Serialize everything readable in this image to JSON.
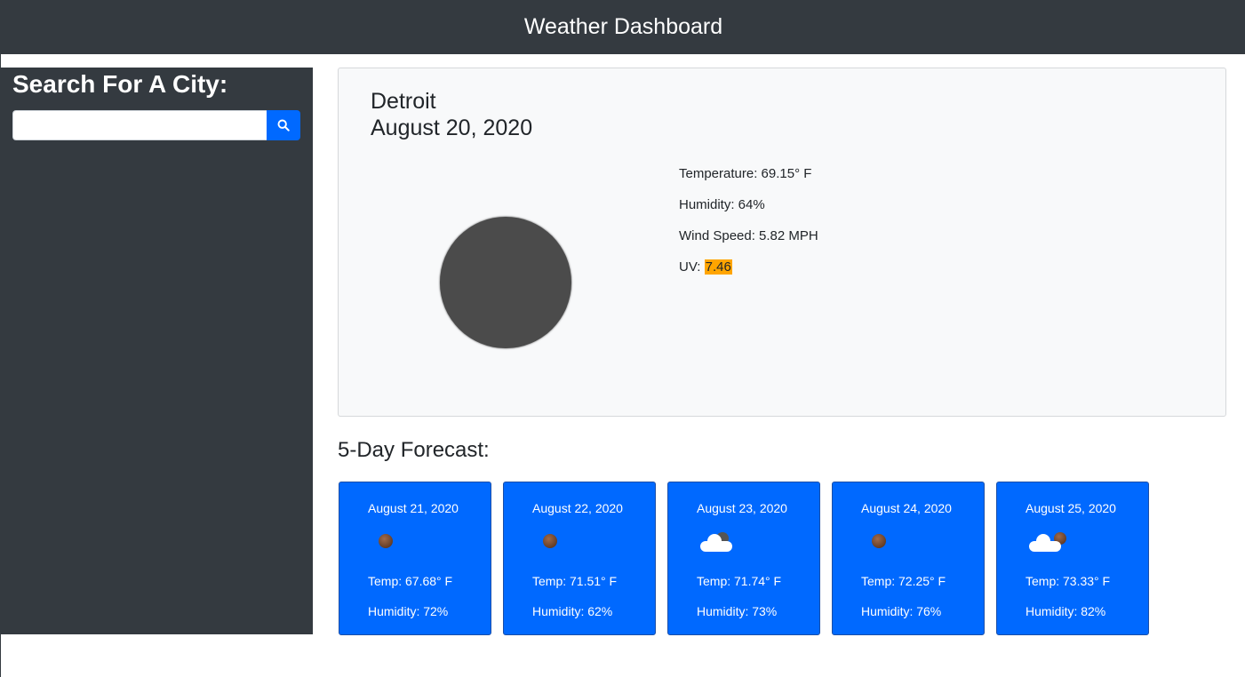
{
  "header": {
    "title": "Weather Dashboard"
  },
  "sidebar": {
    "title": "Search For A City:",
    "search": {
      "value": "",
      "placeholder": "",
      "button_icon": "search-icon"
    }
  },
  "current": {
    "city": "Detroit",
    "date": "August 20, 2020",
    "icon": "dark-circle-weather-icon",
    "temperature_label": "Temperature: 69.15° F",
    "humidity_label": "Humidity: 64%",
    "wind_label": "Wind Speed: 5.82 MPH",
    "uv_prefix": "UV: ",
    "uv_value": "7.46",
    "uv_color": "#ffa500"
  },
  "forecast": {
    "title": "5-Day Forecast:",
    "days": [
      {
        "date": "August 21, 2020",
        "icon": "clear-ball-icon",
        "temp": "Temp: 67.68° F",
        "humidity": "Humidity: 72%"
      },
      {
        "date": "August 22, 2020",
        "icon": "clear-ball-icon",
        "temp": "Temp: 71.51° F",
        "humidity": "Humidity: 62%"
      },
      {
        "date": "August 23, 2020",
        "icon": "cloud-icon",
        "temp": "Temp: 71.74° F",
        "humidity": "Humidity: 73%"
      },
      {
        "date": "August 24, 2020",
        "icon": "clear-ball-icon",
        "temp": "Temp: 72.25° F",
        "humidity": "Humidity: 76%"
      },
      {
        "date": "August 25, 2020",
        "icon": "partly-cloudy-icon",
        "temp": "Temp: 73.33° F",
        "humidity": "Humidity: 82%"
      }
    ]
  },
  "colors": {
    "header_bg": "#343a40",
    "card_blue": "#0069ff",
    "panel_bg": "#f8f9fa"
  }
}
